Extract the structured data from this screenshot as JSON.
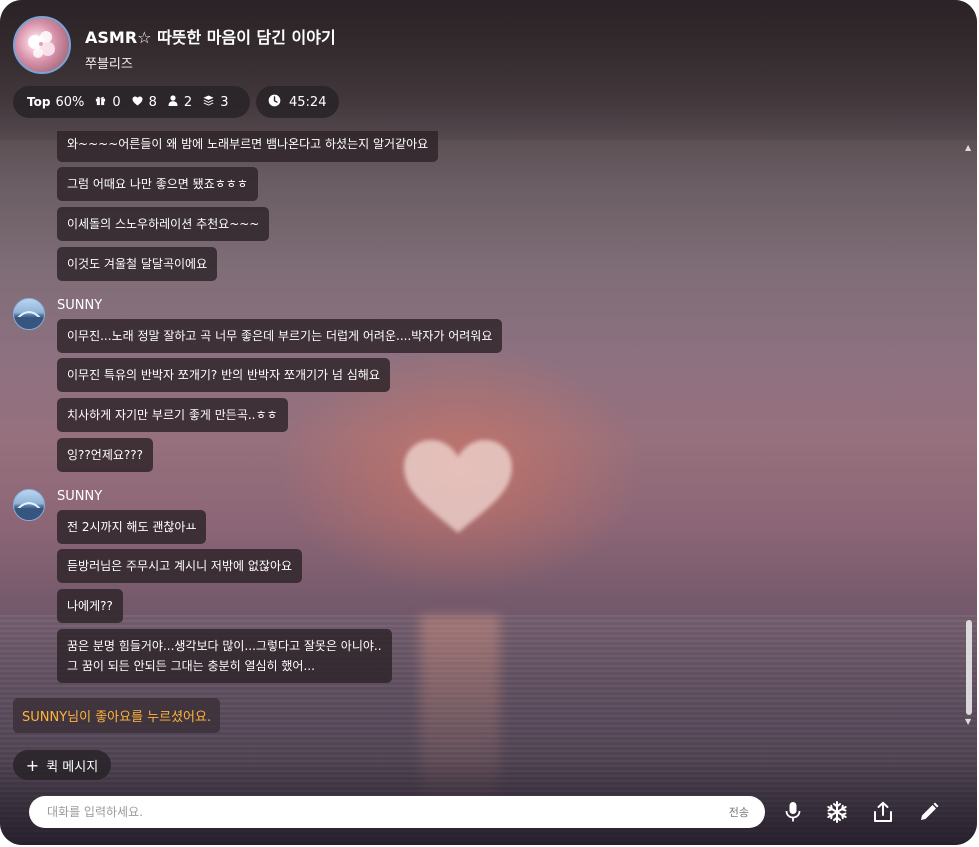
{
  "header": {
    "title": "ASMR☆ 따뜻한 마음이 담긴 이야기",
    "host": "쭈블리즈"
  },
  "stats": {
    "top_label": "Top",
    "top_value": "60%",
    "gifts": "0",
    "likes": "8",
    "listeners": "2",
    "layers": "3",
    "timer": "45:24"
  },
  "messages": {
    "first_group": [
      "와~~~~어른들이 왜 밤에 노래부르면 뱀나온다고 하셨는지 알거같아요",
      "그럼 어때요 나만 좋으면 됐죠ㅎㅎㅎ",
      "이세돌의 스노우하레이션 추천요~~~",
      "이것도 겨울철 달달곡이에요"
    ],
    "group2": {
      "sender": "SUNNY",
      "lines": [
        "이무진...노래 정말 잘하고 곡 너무 좋은데 부르기는 더럽게 어려운....박자가 어려워요",
        "이무진 특유의 반박자 쪼개기? 반의 반박자 쪼개기가 넘 심해요",
        "치사하게 자기만 부르기 좋게 만든곡..ㅎㅎ",
        "잉??언제요???"
      ]
    },
    "group3": {
      "sender": "SUNNY",
      "lines": [
        "전 2시까지 해도 괜찮아ㅛ",
        "듣방러님은 주무시고 계시니 저밖에 없잖아요",
        "나에게??"
      ],
      "multiline": [
        "꿈은 분명 힘들거야...생각보다 많이...그렇다고 잘못은 아니야..",
        "그 꿈이 되든 안되든 그대는 충분히 열심히 했어..."
      ]
    }
  },
  "notice": "SUNNY님이 좋아요를 누르셨어요.",
  "quick_message": "퀵 메시지",
  "input": {
    "placeholder": "대화를 입력하세요.",
    "send_label": "전송"
  },
  "colors": {
    "notice_text": "#ffb43a",
    "bubble_bg": "#2d2328",
    "avatar_ring": "#7aa3d6"
  },
  "icons": {
    "gift": "gift-icon",
    "like": "heart-icon",
    "listeners": "person-icon",
    "layers": "layers-icon",
    "timer": "clock-icon",
    "mic": "microphone-icon",
    "effect": "snowflake-icon",
    "share": "share-icon",
    "edit": "pencil-icon"
  }
}
